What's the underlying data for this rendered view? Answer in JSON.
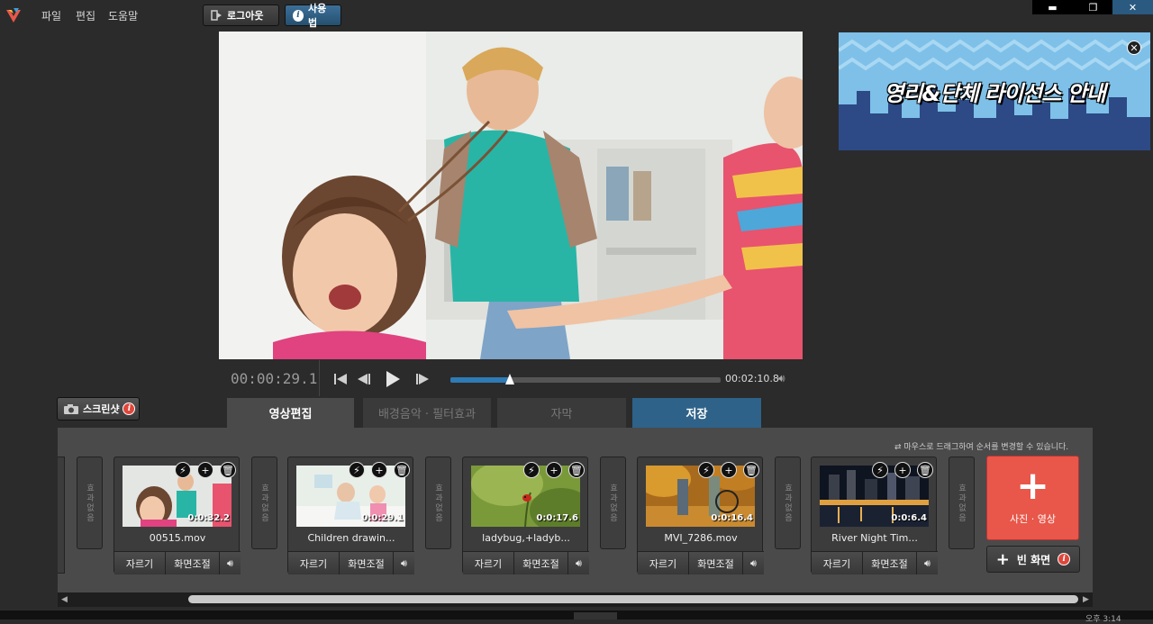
{
  "menu": {
    "file": "파일",
    "edit": "편집",
    "help": "도움말"
  },
  "toolbar": {
    "logout": "로그아웃",
    "howto": "사용법"
  },
  "window": {
    "minimize": "▬",
    "restore": "❐",
    "close": "✕"
  },
  "banner": {
    "text": "영리&단체 라이선스 안내",
    "close": "✕"
  },
  "player": {
    "current_time": "00:00:29.1",
    "duration": "00:02:10.8",
    "progress_fraction": 0.22
  },
  "screenshot": {
    "label": "스크린샷"
  },
  "tabs": [
    {
      "label": "영상편집"
    },
    {
      "label": "배경음악 · 필터효과"
    },
    {
      "label": "자막"
    },
    {
      "label": "저장"
    }
  ],
  "timeline": {
    "hint": "마우스로 드래그하여 순서를 변경할 수 있습니다.",
    "fx_label": "효과없음",
    "clips": [
      {
        "name": "00515.mov",
        "duration": "0:0:32.2"
      },
      {
        "name": "Children drawin...",
        "duration": "0:0:29.1"
      },
      {
        "name": "ladybug,+ladyb...",
        "duration": "0:0:17.6"
      },
      {
        "name": "MVI_7286.mov",
        "duration": "0:0:16.4"
      },
      {
        "name": "River Night Tim...",
        "duration": "0:0:6.4"
      }
    ],
    "clip_buttons": {
      "cut": "자르기",
      "adjust": "화면조절"
    },
    "add_media": "사진 · 영상",
    "add_blank": "빈 화면"
  },
  "status": {
    "bottom_right": "오후 3:14"
  },
  "colors": {
    "accent_blue": "#2e6288",
    "add_red": "#e8574a"
  }
}
